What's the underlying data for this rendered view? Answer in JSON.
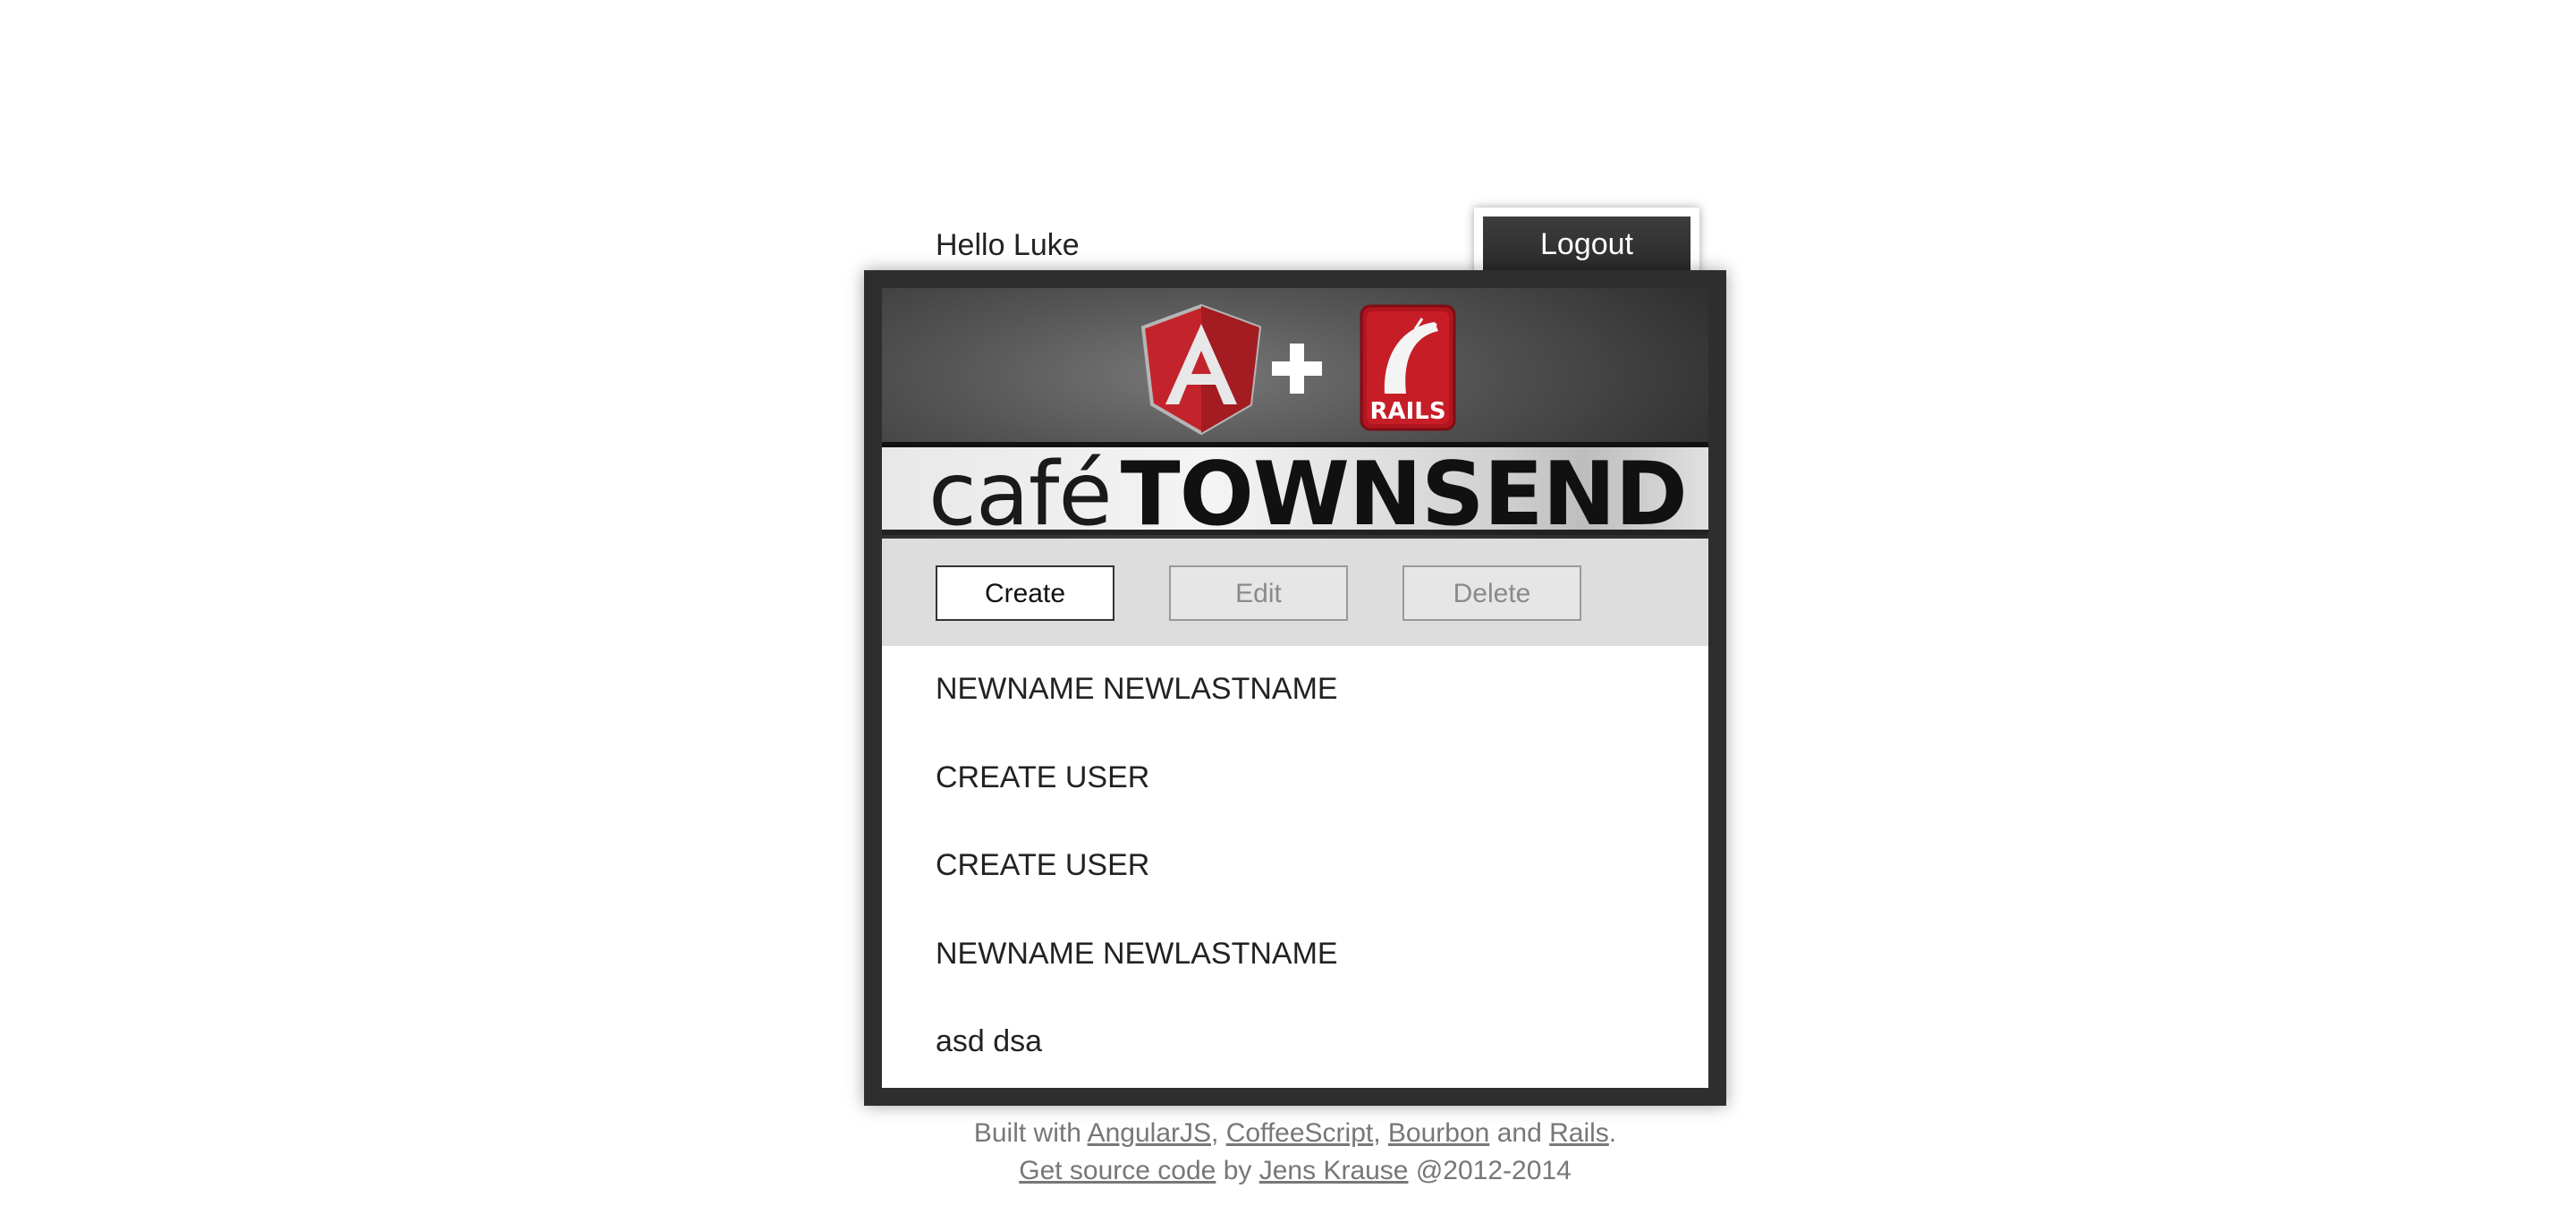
{
  "user": {
    "greeting": "Hello Luke"
  },
  "header": {
    "logout_label": "Logout",
    "brand_cafe": "café",
    "brand_name": "TOWNSEND",
    "plus": "+",
    "rails_badge": "RAILS"
  },
  "toolbar": {
    "create_label": "Create",
    "edit_label": "Edit",
    "delete_label": "Delete"
  },
  "employees": [
    "NEWNAME NEWLASTNAME",
    "CREATE USER",
    "CREATE USER",
    "NEWNAME NEWLASTNAME",
    "asd dsa"
  ],
  "footer": {
    "built_with": "Built with",
    "angular": "AngularJS",
    "sep1": ",",
    "coffeescript": "CoffeeScript",
    "sep2": ",",
    "bourbon": "Bourbon",
    "and": "and",
    "rails": "Rails",
    "period": ".",
    "source": "Get source code",
    "by": "by",
    "author": "Jens Krause",
    "copyright": "@2012-2014"
  },
  "colors": {
    "frame": "#2e2e2e",
    "toolbar_bg": "#dddddd",
    "angular_red": "#c3242b",
    "rails_red": "#b0151f",
    "footer_text": "#777777"
  }
}
